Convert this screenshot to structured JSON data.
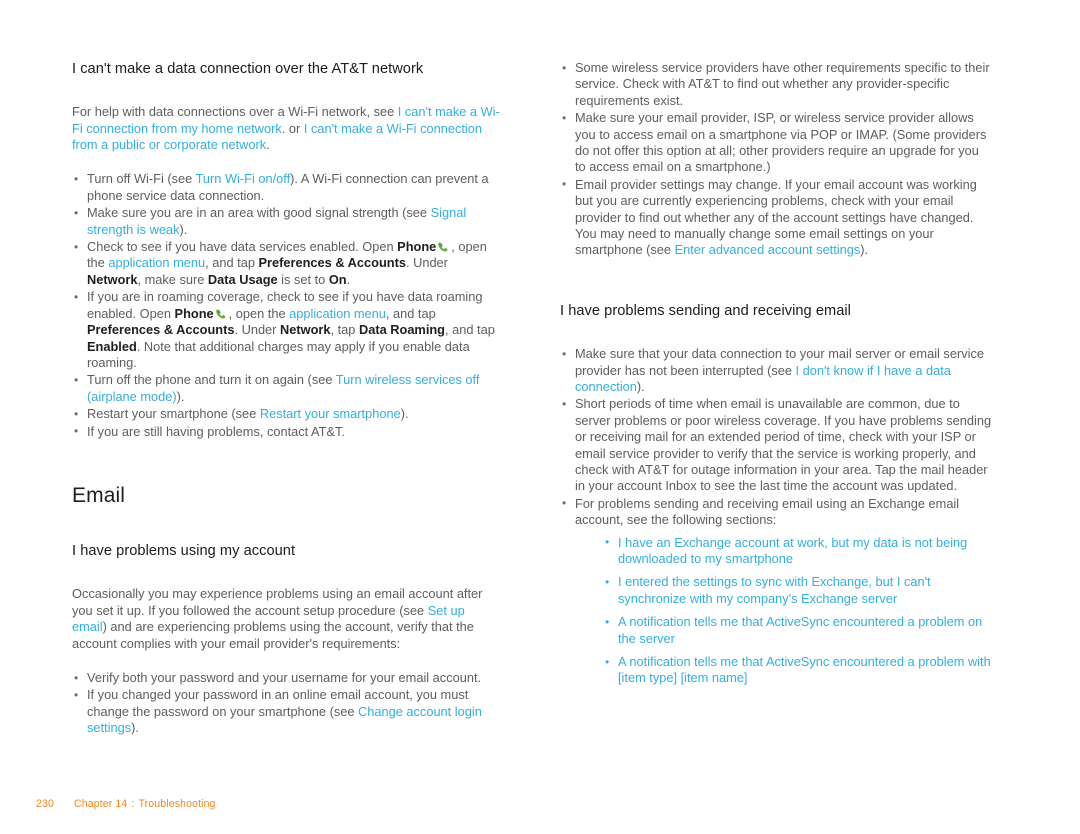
{
  "document": {
    "page_number": "230",
    "footer_chapter": "Chapter 14",
    "footer_separator": ":",
    "footer_section": "Troubleshooting",
    "link_color": "#34aede",
    "footer_color": "#f4861f",
    "body_color": "#5e5e5e",
    "heading_color": "#1f1f1f"
  },
  "left_column": {
    "heading_1": "I can't make a data connection over the AT&T network",
    "intro": {
      "part_1": "For help with data connections over a Wi-Fi network, see ",
      "link_1": "I can't make a Wi-Fi connection from my home network",
      "part_2": ". or ",
      "link_2": "I can't make a Wi-Fi connection from a public or corporate network",
      "part_3": "."
    },
    "bullets": [
      {
        "p1": "Turn off Wi-Fi (see ",
        "l1": "Turn Wi-Fi on/off",
        "p2": "). A Wi-Fi connection can prevent a phone service data connection."
      },
      {
        "p1": "Make sure you are in an area with good signal strength (see ",
        "l1": "Signal strength is weak",
        "p2": ")."
      },
      {
        "p1": "Check to see if you have data services enabled. Open ",
        "b1": "Phone",
        "icon": "phone-icon",
        "p2": ", open the ",
        "l1": "application menu",
        "p3": ", and tap ",
        "b2": "Preferences & Accounts",
        "p4": ". Under ",
        "b3": "Network",
        "p5": ", make sure ",
        "b4": "Data Usage",
        "p6": " is set to ",
        "b5": "On",
        "p7": "."
      },
      {
        "p1": "If you are in roaming coverage, check to see if you have data roaming enabled. Open ",
        "b1": "Phone",
        "icon": "phone-icon",
        "p2": ", open the ",
        "l1": "application menu",
        "p3": ", and tap ",
        "b2": "Preferences & Accounts",
        "p4": ". Under ",
        "b3": "Network",
        "p5": ", tap ",
        "b4": "Data Roaming",
        "p6": ", and tap ",
        "b5": "Enabled",
        "p7": ". Note that additional charges may apply if you enable data roaming."
      },
      {
        "p1": "Turn off the phone and turn it on again (see ",
        "l1": "Turn wireless services off (airplane mode)",
        "p2": ")."
      },
      {
        "p1": "Restart your smartphone (see ",
        "l1": "Restart your smartphone",
        "p2": ")."
      },
      {
        "p1": "If you are still having problems, contact AT&T."
      }
    ],
    "heading_email": "Email",
    "heading_2": "I have problems using my account",
    "paragraph_account": {
      "p1": "Occasionally you may experience problems using an email account after you set it up. If you followed the account setup procedure (see ",
      "l1": "Set up email",
      "p2": ") and are experiencing problems using the account, verify that the account complies with your email provider's requirements:"
    },
    "bullets_2": [
      {
        "p1": "Verify both your password and your username for your email account."
      },
      {
        "p1": "If you changed your password in an online email account, you must change the password on your smartphone (see ",
        "l1": "Change account login settings",
        "p2": ")."
      }
    ]
  },
  "right_column": {
    "bullets_top": [
      {
        "p1": "Some wireless service providers have other requirements specific to their service. Check with AT&T to find out whether any provider-specific requirements exist."
      },
      {
        "p1": "Make sure your email provider, ISP, or wireless service provider allows you to access email on a smartphone via POP or IMAP. (Some providers do not offer this option at all; other providers require an upgrade for you to access email on a smartphone.)"
      },
      {
        "p1": "Email provider settings may change. If your email account was working but you are currently experiencing problems, check with your email provider to find out whether any of the account settings have changed. You may need to manually change some email settings on your smartphone (see ",
        "l1": "Enter advanced account settings",
        "p2": ")."
      }
    ],
    "heading_1": "I have problems sending and receiving email",
    "bullets_bottom": [
      {
        "p1": "Make sure that your data connection to your mail server or email service provider has not been interrupted (see ",
        "l1": "I don't know if I have a data connection",
        "p2": ")."
      },
      {
        "p1": "Short periods of time when email is unavailable are common, due to server problems or poor wireless coverage. If you have problems sending or receiving mail for an extended period of time, check with your ISP or email service provider to verify that the service is working properly, and check with AT&T for outage information in your area. Tap the mail header in your account Inbox to see the last time the account was updated."
      },
      {
        "p1": "For problems sending and receiving email using an Exchange email account, see the following sections:"
      }
    ],
    "nested_links": [
      "I have an Exchange account at work, but my data is not being downloaded to my smartphone",
      "I entered the settings to sync with Exchange, but I can't synchronize with my company's Exchange server",
      "A notification tells me that ActiveSync encountered a problem on the server",
      "A notification tells me that ActiveSync encountered a problem with [item type] [item name]"
    ]
  }
}
